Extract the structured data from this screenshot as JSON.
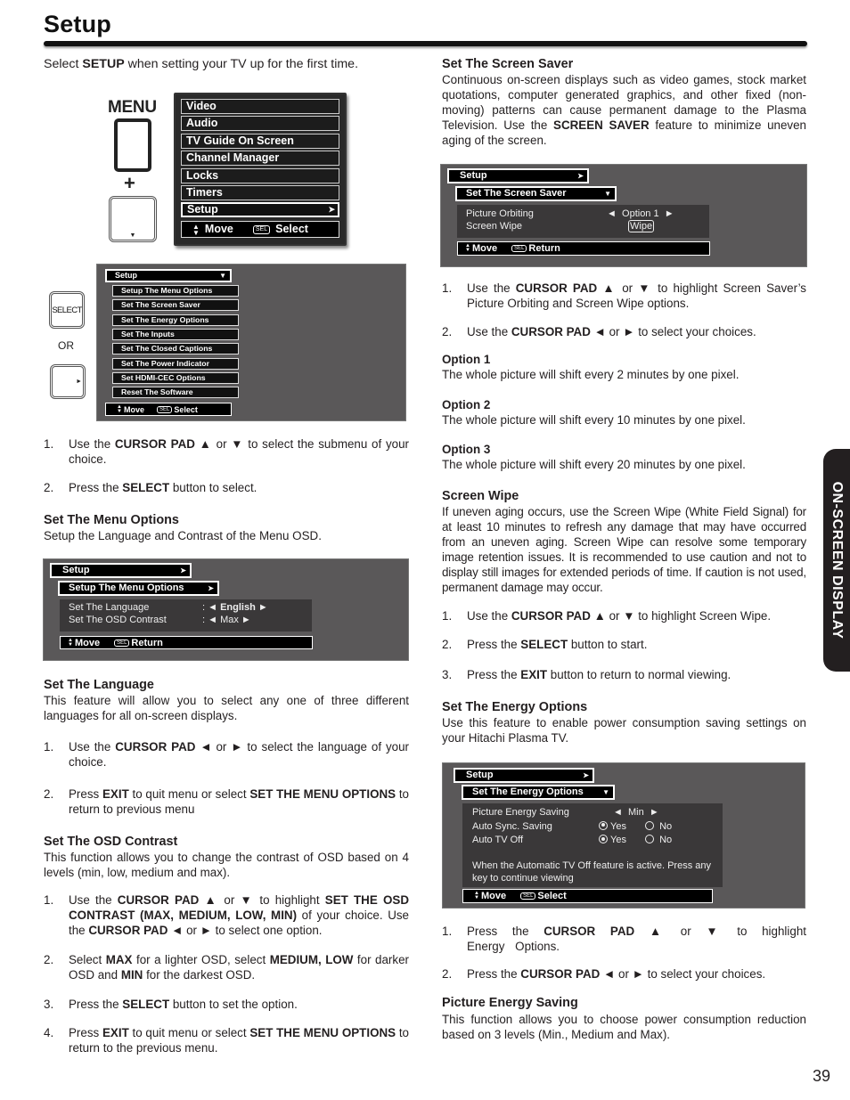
{
  "page": {
    "title": "Setup",
    "intro_pre": "Select ",
    "intro_bold": "SETUP",
    "intro_post": " when setting your TV up for the first time.",
    "side_tab": "ON-SCREEN DISPLAY",
    "page_number": "39"
  },
  "remote": {
    "menu_label": "MENU",
    "plus": "+",
    "down_arrow": "▼",
    "select_label": "SELECT",
    "or_label": "OR",
    "right_arrow": "►"
  },
  "main_menu": {
    "items": [
      "Video",
      "Audio",
      "TV Guide On Screen",
      "Channel Manager",
      "Locks",
      "Timers",
      "Setup"
    ],
    "selected": "Setup",
    "selected_chevron": "➤",
    "footer_move": "Move",
    "footer_sel_badge": "SEL",
    "footer_action": "Select"
  },
  "setup_submenu": {
    "header": "Setup",
    "header_chevron": "▼",
    "items": [
      "Setup The Menu Options",
      "Set The Screen Saver",
      "Set The Energy Options",
      "Set The Inputs",
      "Set The Closed Captions",
      "Set The Power Indicator",
      "Set HDMI-CEC Options",
      "Reset The Software"
    ],
    "footer_move": "Move",
    "footer_sel_badge": "SEL",
    "footer_action": "Select"
  },
  "left_steps": [
    {
      "num": "1.",
      "pre": "Use the ",
      "bold": "CURSOR PAD",
      "post": " ▲ or ▼ to select the submenu of your choice."
    },
    {
      "num": "2.",
      "pre": "Press the ",
      "bold": "SELECT",
      "post": " button to select."
    }
  ],
  "menu_options": {
    "heading": "Set The Menu Options",
    "desc": "Setup the Language and Contrast of the Menu OSD.",
    "osd": {
      "header": "Setup",
      "subheader": "Setup The Menu Options",
      "chevron": "➤",
      "rows": [
        {
          "label": "Set The Language",
          "sep": ":",
          "left": "◄",
          "value": "English",
          "right": "►",
          "bold": true
        },
        {
          "label": "Set The OSD Contrast",
          "sep": ":",
          "left": "◄",
          "value": "Max",
          "right": "►",
          "bold": false
        }
      ],
      "footer_move": "Move",
      "footer_sel_badge": "SEL",
      "footer_action": "Return"
    }
  },
  "language": {
    "heading": "Set The Language",
    "desc": "This feature will allow you to select any one of three different languages for all on-screen displays.",
    "steps": [
      {
        "num": "1.",
        "html": "Use the <b>CURSOR PAD</b> ◄ or ► to select the language of your choice."
      },
      {
        "num": "2.",
        "html": "Press <b>EXIT</b> to quit menu or select <b>SET THE MENU OPTIONS</b> to return to previous menu"
      }
    ]
  },
  "osd_contrast": {
    "heading": "Set The OSD Contrast",
    "desc": "This function allows you to change the contrast of OSD based on 4 levels (min, low, medium and max).",
    "steps": [
      {
        "num": "1.",
        "html": "Use the <b>CURSOR PAD</b> ▲ or ▼ to highlight <b>SET THE OSD CONTRAST (MAX, MEDIUM, LOW, MIN)</b> of your choice. Use the <b>CURSOR PAD</b> ◄ or ► to select one option."
      },
      {
        "num": "2.",
        "html": "Select <b>MAX</b> for a lighter OSD, select <b>MEDIUM, LOW</b> for darker OSD and <b>MIN</b> for the darkest OSD."
      },
      {
        "num": "3.",
        "html": "Press the <b>SELECT</b> button to set the option."
      },
      {
        "num": "4.",
        "html": "Press <b>EXIT</b> to quit menu or select <b>SET THE MENU OPTIONS</b> to return to the previous menu."
      }
    ]
  },
  "screen_saver": {
    "heading": "Set The Screen Saver",
    "desc_html": "Continuous on-screen displays such as video games, stock market quotations, computer generated graphics, and other fixed (non-moving) patterns can cause permanent damage to the Plasma Television. Use the <b>SCREEN SAVER</b> feature to minimize uneven aging of the screen.",
    "osd": {
      "header": "Setup",
      "header_chevron": "➤",
      "subheader": "Set The Screen Saver",
      "sub_chevron": "▼",
      "rows": [
        {
          "label": "Picture Orbiting",
          "left": "◄",
          "value": "Option 1",
          "right": "►"
        },
        {
          "label": "Screen Wipe",
          "button": "Wipe"
        }
      ],
      "footer_move": "Move",
      "footer_sel_badge": "SEL",
      "footer_action": "Return"
    },
    "steps": [
      {
        "num": "1.",
        "html": "Use the <b>CURSOR PAD</b> ▲ or ▼ to highlight Screen Saver’s Picture Orbiting and Screen Wipe options."
      },
      {
        "num": "2.",
        "html": "Use the <b>CURSOR PAD</b> ◄ or ► to select your choices."
      }
    ],
    "options": [
      {
        "title": "Option 1",
        "text": "The whole picture will shift every 2 minutes by one pixel."
      },
      {
        "title": "Option 2",
        "text": "The whole picture will shift every 10 minutes by one pixel."
      },
      {
        "title": "Option 3",
        "text": "The whole picture will shift every 20 minutes by one pixel."
      }
    ]
  },
  "screen_wipe": {
    "heading": "Screen Wipe",
    "desc": "If uneven aging occurs, use the Screen Wipe (White Field Signal) for at least 10 minutes to refresh any damage that may have occurred from an uneven aging. Screen Wipe can resolve some temporary image retention issues. It is recommended to use caution and not to display still images for extended periods of time. If caution is not used, permanent damage may occur.",
    "steps": [
      {
        "num": "1.",
        "html": "Use the <b>CURSOR PAD</b> ▲ or ▼ to highlight Screen Wipe."
      },
      {
        "num": "2.",
        "html": "Press the <b>SELECT</b> button to start."
      },
      {
        "num": "3.",
        "html": "Press the <b>EXIT</b> button to return to normal viewing."
      }
    ]
  },
  "energy": {
    "heading": "Set The Energy Options",
    "desc": "Use this feature to enable power consumption saving settings on your Hitachi Plasma TV.",
    "osd": {
      "header": "Setup",
      "header_chevron": "➤",
      "subheader": "Set The Energy Options",
      "sub_chevron": "▼",
      "picture_energy": {
        "label": "Picture Energy Saving",
        "left": "◄",
        "value": "Min",
        "right": "►"
      },
      "auto_sync": {
        "label": "Auto Sync. Saving",
        "yes": "Yes",
        "no": "No",
        "selected": "Yes"
      },
      "auto_off": {
        "label": "Auto TV Off",
        "yes": "Yes",
        "no": "No",
        "selected": "Yes"
      },
      "note": "When the Automatic TV Off feature is active. Press any key to continue viewing",
      "footer_move": "Move",
      "footer_sel_badge": "SEL",
      "footer_action": "Select"
    },
    "steps": [
      {
        "num": "1.",
        "html": "Press the <b>CURSOR PAD</b> ▲ or ▼ to highlight Energy Options."
      },
      {
        "num": "2.",
        "html": "Press the <b>CURSOR PAD</b> ◄ or ► to select your choices."
      }
    ]
  },
  "picture_energy_saving": {
    "heading": "Picture Energy Saving",
    "desc": "This function allows you to choose power consumption reduction based on 3 levels (Min., Medium and Max)."
  }
}
